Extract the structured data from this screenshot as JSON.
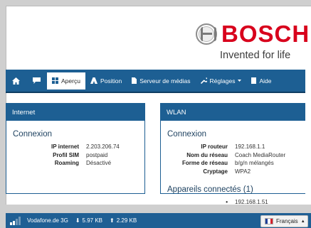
{
  "brand": {
    "name": "BOSCH",
    "tagline": "Invented for life",
    "logo_icon": "bosch-armature-icon",
    "color": "#d8001c"
  },
  "nav": {
    "items": [
      {
        "label": "",
        "icon": "home-icon"
      },
      {
        "label": "",
        "icon": "message-icon"
      },
      {
        "label": "Aperçu",
        "icon": "grid-icon",
        "active": true
      },
      {
        "label": "Position",
        "icon": "position-icon"
      },
      {
        "label": "Serveur de médias",
        "icon": "file-icon"
      },
      {
        "label": "Réglages",
        "icon": "wrench-icon",
        "dropdown": true
      },
      {
        "label": "Aide",
        "icon": "book-icon"
      }
    ],
    "color": "#1d5f93"
  },
  "internet": {
    "title": "Internet",
    "section": "Connexion",
    "rows": [
      {
        "key": "IP internet",
        "value": "2.203.206.74"
      },
      {
        "key": "Profil SIM",
        "value": "postpaid"
      },
      {
        "key": "Roaming",
        "value": "Désactivé"
      }
    ]
  },
  "wlan": {
    "title": "WLAN",
    "section": "Connexion",
    "rows": [
      {
        "key": "IP routeur",
        "value": "192.168.1.1"
      },
      {
        "key": "Nom du réseau",
        "value": "Coach MediaRouter"
      },
      {
        "key": "Forme de réseau",
        "value": "b/g/n mélangés"
      },
      {
        "key": "Cryptage",
        "value": "WPA2"
      }
    ],
    "devices_title": "Appareils connectés (1)",
    "devices": [
      {
        "bullet": "•",
        "ip": "192.168.1.51"
      }
    ]
  },
  "footer": {
    "operator": "Vodafone.de 3G",
    "download": "5.97 KB",
    "upload": "2.29 KB",
    "signal_bars_active": 2,
    "signal_bars_total": 4,
    "language": "Français"
  }
}
